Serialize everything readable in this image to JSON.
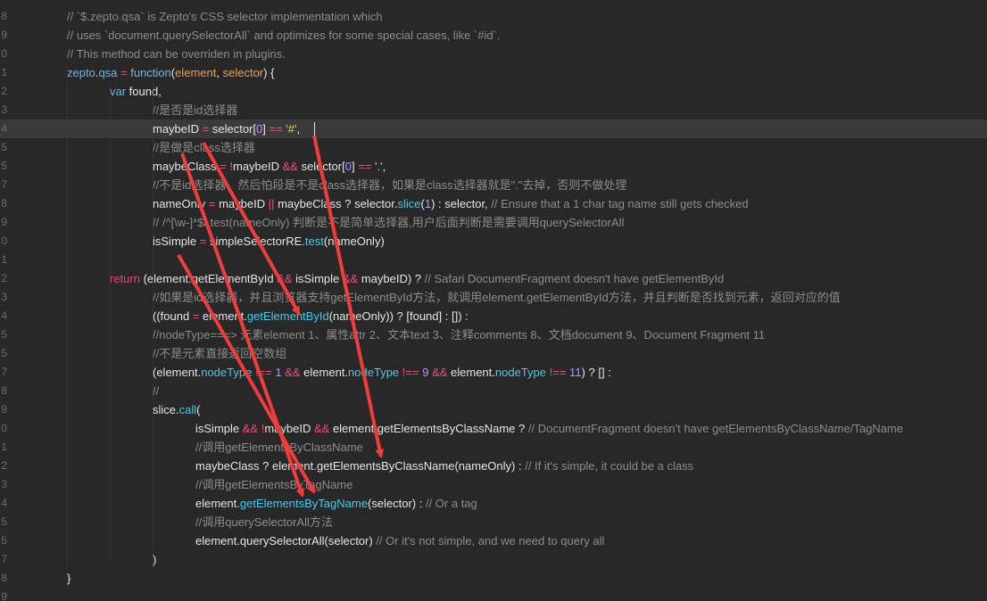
{
  "line_numbers": [
    "8",
    "9",
    "0",
    "1",
    "2",
    "3",
    "4",
    "5",
    "5",
    "7",
    "8",
    "9",
    "0",
    "1",
    "2",
    "3",
    "4",
    "5",
    "5",
    "7",
    "8",
    "9",
    "0",
    "1",
    "2",
    "3",
    "4",
    "5",
    "5",
    "7",
    "8",
    "9"
  ],
  "lines": [
    {
      "ln": "8",
      "indent": 75,
      "tokens": [
        {
          "t": "// `$.zepto.qsa` is Zepto's CSS selector implementation which",
          "c": "c"
        }
      ]
    },
    {
      "ln": "9",
      "indent": 75,
      "tokens": [
        {
          "t": "// uses `document.querySelectorAll` and optimizes for some special cases, like `#id`.",
          "c": "c"
        }
      ]
    },
    {
      "ln": "0",
      "indent": 75,
      "tokens": [
        {
          "t": "// This method can be overriden in plugins.",
          "c": "c"
        }
      ]
    },
    {
      "ln": "1",
      "indent": 75,
      "tokens": [
        {
          "t": "zepto",
          "c": "kb"
        },
        {
          "t": ".",
          "c": ""
        },
        {
          "t": "qsa",
          "c": "kb"
        },
        {
          "t": " = ",
          "c": "o"
        },
        {
          "t": "function",
          "c": "kb"
        },
        {
          "t": "(",
          "c": ""
        },
        {
          "t": "element",
          "c": "p"
        },
        {
          "t": ", ",
          "c": ""
        },
        {
          "t": "selector",
          "c": "p"
        },
        {
          "t": ") {",
          "c": ""
        }
      ]
    },
    {
      "ln": "2",
      "indent": 123,
      "tokens": [
        {
          "t": "var",
          "c": "kb"
        },
        {
          "t": " found,",
          "c": ""
        }
      ]
    },
    {
      "ln": "3",
      "indent": 171,
      "tokens": [
        {
          "t": "//是否是id选择器",
          "c": "c"
        }
      ]
    },
    {
      "ln": "4",
      "indent": 171,
      "current": true,
      "tokens": [
        {
          "t": "maybeID",
          "c": ""
        },
        {
          "t": " = ",
          "c": "o"
        },
        {
          "t": "selector[",
          "c": ""
        },
        {
          "t": "0",
          "c": "n"
        },
        {
          "t": "] ",
          "c": ""
        },
        {
          "t": "==",
          "c": "o"
        },
        {
          "t": " ",
          "c": ""
        },
        {
          "t": "'#'",
          "c": "s"
        },
        {
          "t": ",",
          "c": ""
        }
      ]
    },
    {
      "ln": "5",
      "indent": 171,
      "tokens": [
        {
          "t": "//是做是class选择器",
          "c": "c"
        }
      ]
    },
    {
      "ln": "5",
      "indent": 171,
      "tokens": [
        {
          "t": "maybeClass",
          "c": ""
        },
        {
          "t": " = ",
          "c": "o"
        },
        {
          "t": "!",
          "c": "o"
        },
        {
          "t": "maybeID ",
          "c": ""
        },
        {
          "t": "&&",
          "c": "o"
        },
        {
          "t": " selector[",
          "c": ""
        },
        {
          "t": "0",
          "c": "n"
        },
        {
          "t": "] ",
          "c": ""
        },
        {
          "t": "==",
          "c": "o"
        },
        {
          "t": " ",
          "c": ""
        },
        {
          "t": "'.'",
          "c": "s"
        },
        {
          "t": ",",
          "c": ""
        }
      ]
    },
    {
      "ln": "7",
      "indent": 171,
      "tokens": [
        {
          "t": "//不是id选择器，然后怕段是不是class选择器，如果是class选择器就是\".\"去掉，否则不做处理",
          "c": "c"
        }
      ]
    },
    {
      "ln": "8",
      "indent": 171,
      "tokens": [
        {
          "t": "nameOnly",
          "c": ""
        },
        {
          "t": " = ",
          "c": "o"
        },
        {
          "t": "maybeID ",
          "c": ""
        },
        {
          "t": "||",
          "c": "o"
        },
        {
          "t": " maybeClass ? selector.",
          "c": ""
        },
        {
          "t": "slice",
          "c": "f"
        },
        {
          "t": "(",
          "c": ""
        },
        {
          "t": "1",
          "c": "n"
        },
        {
          "t": ") : selector, ",
          "c": ""
        },
        {
          "t": "// Ensure that a 1 char tag name still gets checked",
          "c": "c"
        }
      ]
    },
    {
      "ln": "9",
      "indent": 171,
      "tokens": [
        {
          "t": "// /^[\\w-]*$/.test(nameOnly) 判断是不是简单选择器,用户后面判断是需要调用querySelectorAll",
          "c": "c"
        }
      ]
    },
    {
      "ln": "0",
      "indent": 171,
      "tokens": [
        {
          "t": "isSimple",
          "c": ""
        },
        {
          "t": " = ",
          "c": "o"
        },
        {
          "t": "simpleSelectorRE.",
          "c": ""
        },
        {
          "t": "test",
          "c": "f"
        },
        {
          "t": "(nameOnly)",
          "c": ""
        }
      ]
    },
    {
      "ln": "1",
      "indent": 0,
      "tokens": []
    },
    {
      "ln": "2",
      "indent": 123,
      "tokens": [
        {
          "t": "return",
          "c": "k"
        },
        {
          "t": " (element.getElementById ",
          "c": ""
        },
        {
          "t": "&&",
          "c": "o"
        },
        {
          "t": " isSimple ",
          "c": ""
        },
        {
          "t": "&&",
          "c": "o"
        },
        {
          "t": " maybeID) ? ",
          "c": ""
        },
        {
          "t": "// Safari DocumentFragment doesn't have getElementById",
          "c": "c"
        }
      ]
    },
    {
      "ln": "3",
      "indent": 171,
      "tokens": [
        {
          "t": "//如果是id选择器，并且浏览器支持getElementById方法，就调用element.getElementById方法，并且判断是否找到元素，返回对应的值",
          "c": "c"
        }
      ]
    },
    {
      "ln": "4",
      "indent": 171,
      "tokens": [
        {
          "t": "((found",
          "c": ""
        },
        {
          "t": " = ",
          "c": "o"
        },
        {
          "t": "element.",
          "c": ""
        },
        {
          "t": "getElementById",
          "c": "f"
        },
        {
          "t": "(nameOnly)) ? [found] : []) :",
          "c": ""
        }
      ]
    },
    {
      "ln": "5",
      "indent": 171,
      "tokens": [
        {
          "t": "//nodeType===> 元素element 1、属性attr 2、文本text 3、注释comments 8、文档document 9、Document Fragment 11",
          "c": "c"
        }
      ]
    },
    {
      "ln": "5",
      "indent": 171,
      "tokens": [
        {
          "t": "//不是元素直接返回空数组",
          "c": "c"
        }
      ]
    },
    {
      "ln": "7",
      "indent": 171,
      "tokens": [
        {
          "t": "(element.",
          "c": ""
        },
        {
          "t": "nodeType",
          "c": "f"
        },
        {
          "t": " ",
          "c": ""
        },
        {
          "t": "!==",
          "c": "o"
        },
        {
          "t": " ",
          "c": ""
        },
        {
          "t": "1",
          "c": "n"
        },
        {
          "t": " ",
          "c": ""
        },
        {
          "t": "&&",
          "c": "o"
        },
        {
          "t": " element.",
          "c": ""
        },
        {
          "t": "nodeType",
          "c": "f"
        },
        {
          "t": " ",
          "c": ""
        },
        {
          "t": "!==",
          "c": "o"
        },
        {
          "t": " ",
          "c": ""
        },
        {
          "t": "9",
          "c": "n"
        },
        {
          "t": " ",
          "c": ""
        },
        {
          "t": "&&",
          "c": "o"
        },
        {
          "t": " element.",
          "c": ""
        },
        {
          "t": "nodeType",
          "c": "f"
        },
        {
          "t": " ",
          "c": ""
        },
        {
          "t": "!==",
          "c": "o"
        },
        {
          "t": " ",
          "c": ""
        },
        {
          "t": "11",
          "c": "n"
        },
        {
          "t": ") ? [] :",
          "c": ""
        }
      ]
    },
    {
      "ln": "8",
      "indent": 171,
      "tokens": [
        {
          "t": "//",
          "c": "c"
        }
      ]
    },
    {
      "ln": "9",
      "indent": 171,
      "tokens": [
        {
          "t": "slice.",
          "c": ""
        },
        {
          "t": "call",
          "c": "f"
        },
        {
          "t": "(",
          "c": ""
        }
      ]
    },
    {
      "ln": "0",
      "indent": 219,
      "tokens": [
        {
          "t": "isSimple ",
          "c": ""
        },
        {
          "t": "&&",
          "c": "o"
        },
        {
          "t": " ",
          "c": ""
        },
        {
          "t": "!",
          "c": "o"
        },
        {
          "t": "maybeID ",
          "c": ""
        },
        {
          "t": "&&",
          "c": "o"
        },
        {
          "t": " element.getElementsByClassName ? ",
          "c": ""
        },
        {
          "t": "// DocumentFragment doesn't have getElementsByClassName/TagName",
          "c": "c"
        }
      ]
    },
    {
      "ln": "1",
      "indent": 219,
      "tokens": [
        {
          "t": "//调用getElementsByClassName",
          "c": "c"
        }
      ]
    },
    {
      "ln": "2",
      "indent": 219,
      "tokens": [
        {
          "t": "maybeClass ? element.getElementsByClassName(nameOnly) : ",
          "c": ""
        },
        {
          "t": "// If it's simple, it could be a class",
          "c": "c"
        }
      ]
    },
    {
      "ln": "3",
      "indent": 219,
      "tokens": [
        {
          "t": "//调用getElementsByTagName",
          "c": "c"
        }
      ]
    },
    {
      "ln": "4",
      "indent": 219,
      "tokens": [
        {
          "t": "element.",
          "c": ""
        },
        {
          "t": "getElementsByTagName",
          "c": "f"
        },
        {
          "t": "(selector) : ",
          "c": ""
        },
        {
          "t": "// Or a tag",
          "c": "c"
        }
      ]
    },
    {
      "ln": "5",
      "indent": 219,
      "tokens": [
        {
          "t": "//调用querySelectorAll方法",
          "c": "c"
        }
      ]
    },
    {
      "ln": "5",
      "indent": 219,
      "tokens": [
        {
          "t": "element.querySelectorAll(selector) ",
          "c": ""
        },
        {
          "t": "// Or it's not simple, and we need to query all",
          "c": "c"
        }
      ]
    },
    {
      "ln": "7",
      "indent": 171,
      "tokens": [
        {
          "t": ")",
          "c": ""
        }
      ]
    },
    {
      "ln": "8",
      "indent": 75,
      "tokens": [
        {
          "t": "}",
          "c": ""
        }
      ]
    },
    {
      "ln": "9",
      "indent": 0,
      "tokens": []
    }
  ],
  "colors": {
    "background": "#282828",
    "current_line": "#3a3a3a",
    "comment": "#8d8d8d",
    "keyword": "#6fb5e9",
    "function_call": "#4fc7e8",
    "param": "#f29d4d",
    "string": "#e5d46f",
    "number": "#b795ff",
    "operator": "#f0507d",
    "annotation_arrow": "#f03c3c"
  },
  "annotation_arrows": [
    {
      "name": "arrow-maybeid-to-getelementbyid"
    },
    {
      "name": "arrow-maybeid-to-getelementsbyclassname"
    },
    {
      "name": "arrow-maybeclass-to-getelementsbytagname"
    },
    {
      "name": "arrow-issimple-to-getelementsbytagname"
    }
  ]
}
